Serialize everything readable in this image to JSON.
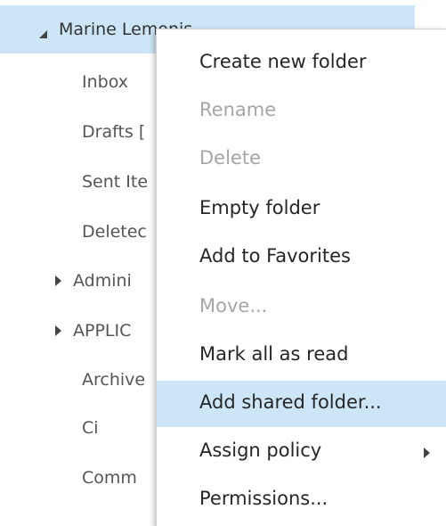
{
  "account": {
    "name": "Marine Lemonis"
  },
  "folders": [
    {
      "label": "Inbox",
      "expandable": false
    },
    {
      "label": "Drafts [",
      "expandable": false
    },
    {
      "label": "Sent Ite",
      "expandable": false
    },
    {
      "label": "Deletec",
      "expandable": false
    },
    {
      "label": "Admini",
      "expandable": true
    },
    {
      "label": "APPLIC",
      "expandable": true
    },
    {
      "label": "Archive",
      "expandable": false
    },
    {
      "label": "Ci",
      "expandable": false
    },
    {
      "label": "Comm",
      "expandable": false
    }
  ],
  "context_menu": {
    "items": [
      {
        "label": "Create new folder",
        "enabled": true
      },
      {
        "label": "Rename",
        "enabled": false
      },
      {
        "label": "Delete",
        "enabled": false
      },
      {
        "label": "Empty folder",
        "enabled": true
      },
      {
        "label": "Add to Favorites",
        "enabled": true
      },
      {
        "label": "Move...",
        "enabled": false
      },
      {
        "label": "Mark all as read",
        "enabled": true
      },
      {
        "label": "Add shared folder...",
        "enabled": true,
        "highlighted": true
      },
      {
        "label": "Assign policy",
        "enabled": true,
        "has_submenu": true
      },
      {
        "label": "Permissions...",
        "enabled": true
      }
    ]
  },
  "colors": {
    "selection": "#cde6f7",
    "text": "#262626",
    "disabled_text": "#a6a6a6"
  }
}
